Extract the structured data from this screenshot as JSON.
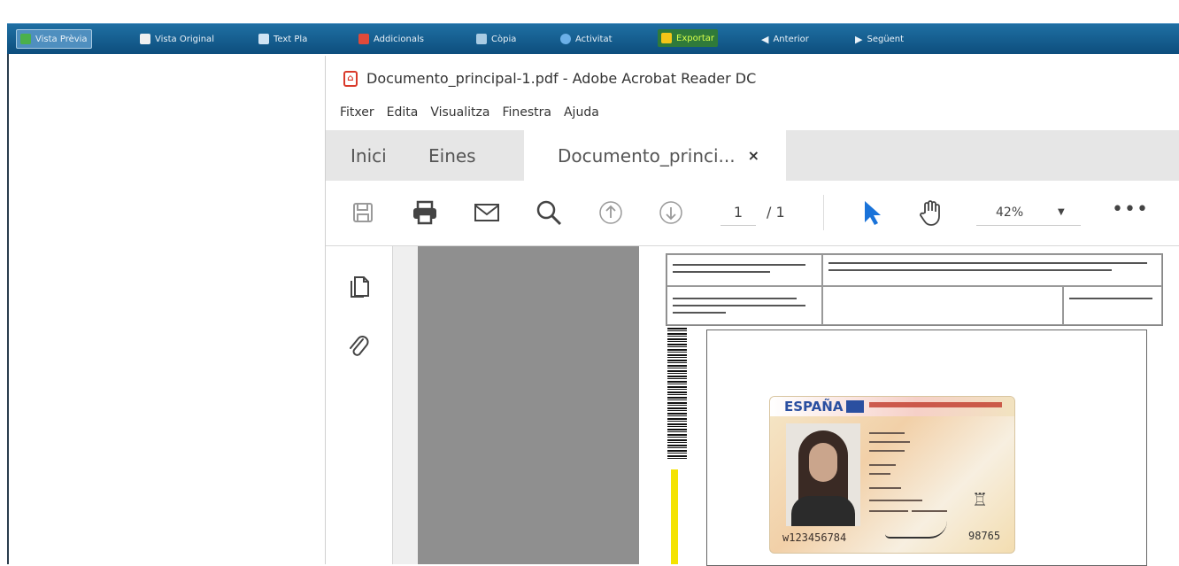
{
  "ribbon": {
    "items": [
      {
        "label": "Vista Prèvia",
        "icon": "preview-icon",
        "color": "#4bb04b"
      },
      {
        "label": "Vista Original",
        "icon": "document-icon",
        "color": "#f0f0f0"
      },
      {
        "label": "Text Pla",
        "icon": "text-icon",
        "color": "#d0e4f4"
      },
      {
        "label": "Addicionals",
        "icon": "pdf-icon",
        "color": "#e04a3a"
      },
      {
        "label": "Còpia",
        "icon": "copy-icon",
        "color": "#a9cbe3"
      },
      {
        "label": "Activitat",
        "icon": "activity-icon",
        "color": "#6cb0e8"
      },
      {
        "label": "Exportar",
        "icon": "export-icon",
        "color": "#f5c518"
      },
      {
        "label": "Anterior",
        "icon": "back-icon",
        "color": "#d0e4f4"
      },
      {
        "label": "Següent",
        "icon": "forward-icon",
        "color": "#d0e4f4"
      }
    ]
  },
  "acrobat": {
    "title": "Documento_principal-1.pdf - Adobe Acrobat Reader DC",
    "menu": [
      "Fitxer",
      "Edita",
      "Visualitza",
      "Finestra",
      "Ajuda"
    ],
    "tabs": {
      "home": "Inici",
      "tools": "Eines",
      "document": "Documento_princi...",
      "close": "×"
    },
    "toolbar": {
      "page_current": "1",
      "page_total": "/ 1",
      "zoom": "42%",
      "more": "•••"
    }
  },
  "document": {
    "card": {
      "country": "ESPAÑA",
      "number": "w123456784",
      "code": "98765"
    }
  }
}
